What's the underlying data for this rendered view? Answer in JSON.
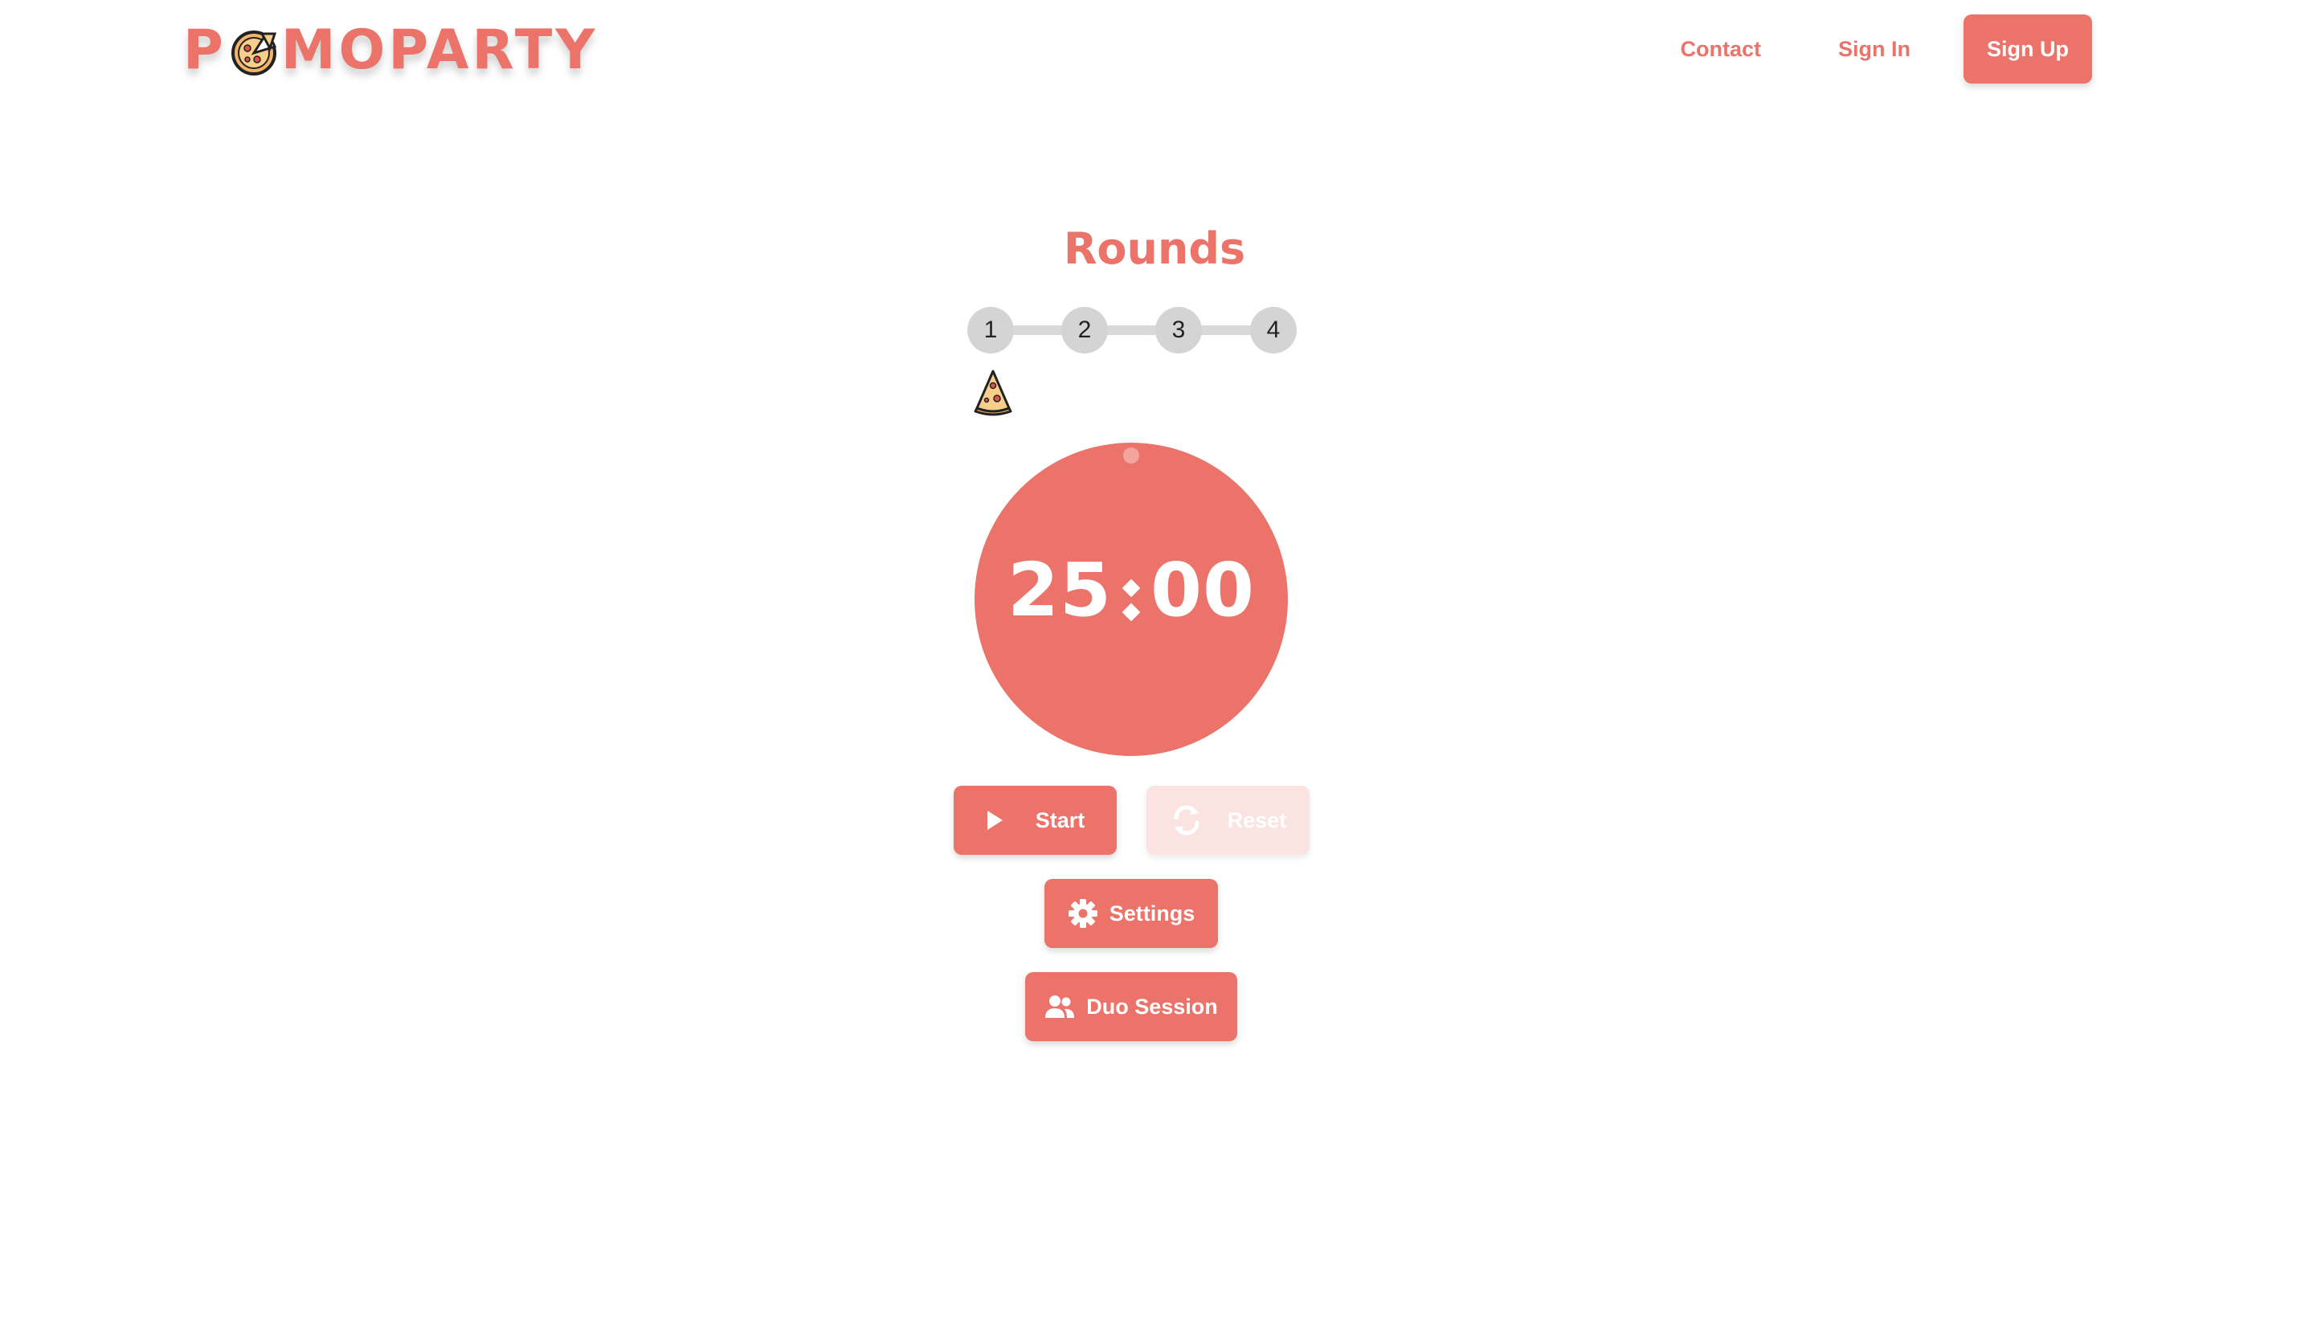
{
  "brand": {
    "name_first": "P",
    "name_rest": "MOPARTY",
    "logo_icon": "pizza-icon"
  },
  "nav": {
    "contact": "Contact",
    "sign_in": "Sign In",
    "sign_up": "Sign Up"
  },
  "rounds": {
    "title": "Rounds",
    "steps": [
      "1",
      "2",
      "3",
      "4"
    ],
    "current": 1,
    "marker_icon": "pizza-slice-icon"
  },
  "timer": {
    "minutes": "25",
    "seconds": "00"
  },
  "controls": {
    "start_label": "Start",
    "start_icon": "play-icon",
    "reset_label": "Reset",
    "reset_icon": "refresh-icon",
    "settings_label": "Settings",
    "settings_icon": "gear-icon",
    "duo_label": "Duo Session",
    "duo_icon": "users-icon"
  },
  "colors": {
    "accent": "#EB7369",
    "accent_light": "#FBE3E1",
    "track": "#D9D9D9"
  }
}
